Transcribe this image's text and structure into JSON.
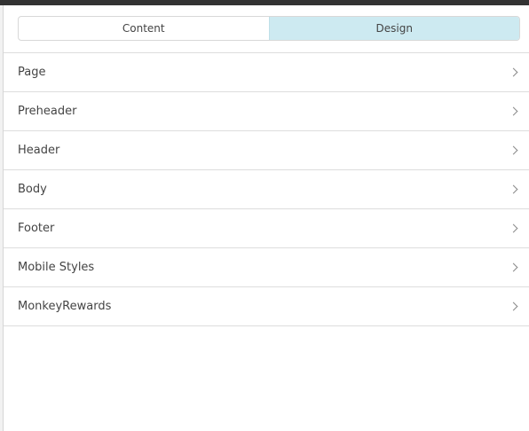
{
  "tabs": [
    {
      "label": "Content",
      "active": false
    },
    {
      "label": "Design",
      "active": true
    }
  ],
  "active_tab_color": "#cdeaf1",
  "sections": [
    {
      "label": "Page",
      "icon": "chevron-right-icon"
    },
    {
      "label": "Preheader",
      "icon": "chevron-right-icon"
    },
    {
      "label": "Header",
      "icon": "chevron-right-icon"
    },
    {
      "label": "Body",
      "icon": "chevron-right-icon"
    },
    {
      "label": "Footer",
      "icon": "chevron-right-icon"
    },
    {
      "label": "Mobile Styles",
      "icon": "chevron-right-icon"
    },
    {
      "label": "MonkeyRewards",
      "icon": "chevron-right-icon"
    }
  ]
}
